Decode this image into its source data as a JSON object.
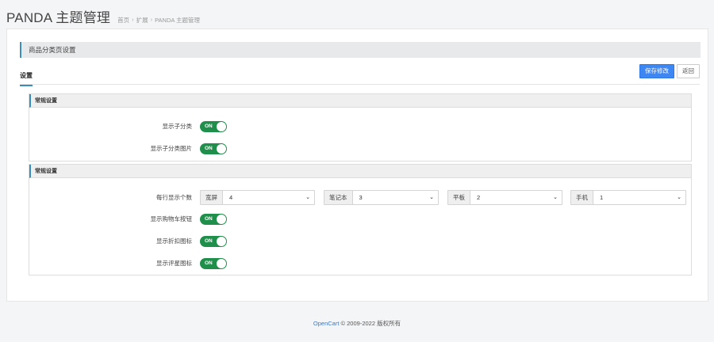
{
  "header": {
    "title": "PANDA 主题管理",
    "breadcrumb": [
      {
        "label": "首页"
      },
      {
        "label": "扩展"
      },
      {
        "label": "PANDA 主题管理"
      }
    ],
    "separator": "›"
  },
  "section": {
    "title": "商品分类页设置"
  },
  "tabs": [
    {
      "label": "设置",
      "active": true
    }
  ],
  "actions": {
    "save_label": "保存修改",
    "back_label": "返回"
  },
  "panels": [
    {
      "title": "常规设置",
      "toggles": [
        {
          "label": "显示子分类",
          "state": "ON"
        },
        {
          "label": "显示子分类图片",
          "state": "ON"
        }
      ]
    },
    {
      "title": "常规设置",
      "columns_label": "每行显示个数",
      "selects": [
        {
          "prefix": "宽屏",
          "value": "4"
        },
        {
          "prefix": "笔记本",
          "value": "3"
        },
        {
          "prefix": "平板",
          "value": "2"
        },
        {
          "prefix": "手机",
          "value": "1"
        }
      ],
      "toggles": [
        {
          "label": "显示购物车按钮",
          "state": "ON"
        },
        {
          "label": "显示折扣图标",
          "state": "ON"
        },
        {
          "label": "显示评星图标",
          "state": "ON"
        }
      ]
    }
  ],
  "footer": {
    "link": "OpenCart",
    "text": " © 2009-2022 版权所有"
  },
  "colors": {
    "accent": "#3c8dbc",
    "primary_button": "#3d87f5",
    "toggle_on": "#1f8f4b"
  }
}
